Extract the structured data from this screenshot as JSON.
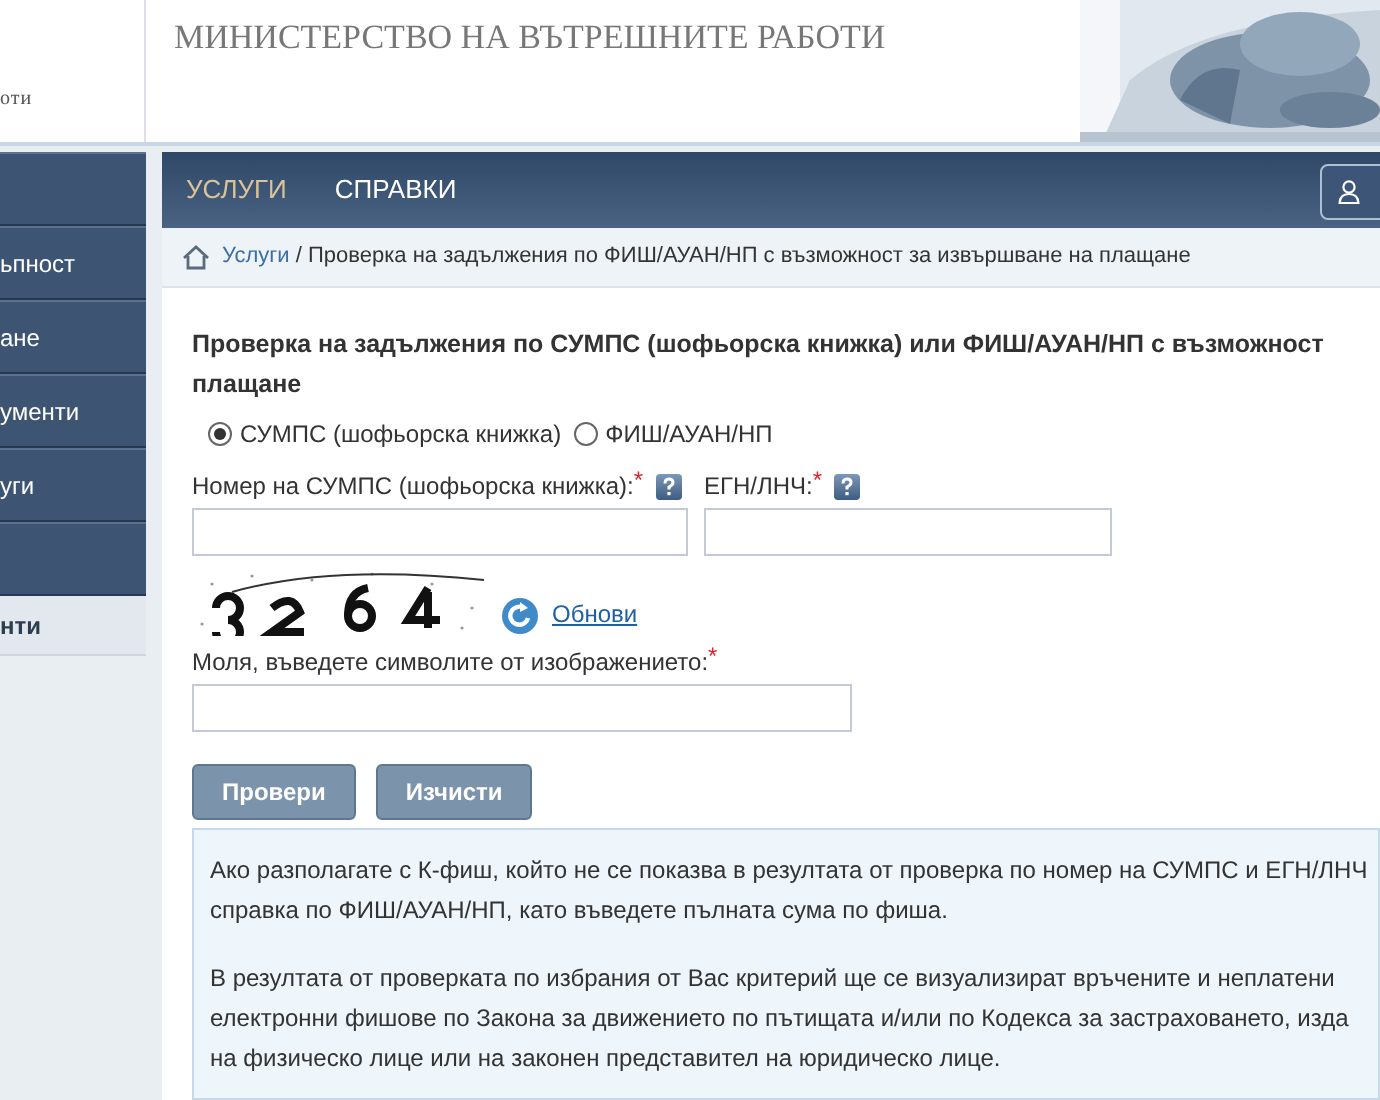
{
  "header": {
    "logo_text": "оти",
    "title": "МИНИСТЕРСТВО НА ВЪТРЕШНИТЕ РАБОТИ"
  },
  "sidebar": {
    "items": [
      {
        "selected": false
      },
      {
        "label": "ьпност",
        "selected": false
      },
      {
        "label": "ане",
        "selected": false
      },
      {
        "label": "ументи",
        "selected": false
      },
      {
        "label": "уги",
        "selected": false
      },
      {
        "selected": false
      },
      {
        "label": "нти",
        "selected": true
      }
    ]
  },
  "nav": {
    "tabs": [
      {
        "label": "УСЛУГИ",
        "selected": true
      },
      {
        "label": "СПРАВКИ",
        "selected": false
      }
    ]
  },
  "breadcrumb": {
    "link": "Услуги",
    "current": "/ Проверка на задължения по ФИШ/АУАН/НП с възможност за извършване на плащане"
  },
  "form": {
    "heading_lines": [
      "Проверка на задължения по СУМПС (шофьорска книжка) или ФИШ/АУАН/НП с възможност",
      "плащане"
    ],
    "options": [
      {
        "label": "СУМПС (шофьорска книжка)",
        "selected": true
      },
      {
        "label": "ФИШ/АУАН/НП",
        "selected": false
      }
    ],
    "fields": [
      {
        "label": "Номер на СУМПС (шофьорска книжка):",
        "required_mark": "*",
        "help": true
      },
      {
        "label": "ЕГН/ЛНЧ:",
        "required_mark": "*",
        "help": true
      }
    ],
    "captcha": {
      "refresh_link": "Обнови"
    },
    "captcha_field": {
      "label": "Моля, въведете символите от изображението:",
      "required_mark": "*"
    },
    "buttons": [
      "Провери",
      "Изчисти"
    ],
    "info": [
      [
        "Ако разполагате с К-фиш, който не се показва в резултата от проверка по номер на СУМПС и ЕГН/ЛНЧ",
        "справка по ФИШ/АУАН/НП, като въведете пълната сума по фиша."
      ],
      [
        "В резултата от проверката по избрания от Вас критерий ще се визуализират връчените и неплатени",
        "електронни фишове по Закона за движението по пътищата и/или по Кодекса за застраховането, изда",
        "на физическо лице или на законен представител на юридическо лице."
      ]
    ]
  }
}
